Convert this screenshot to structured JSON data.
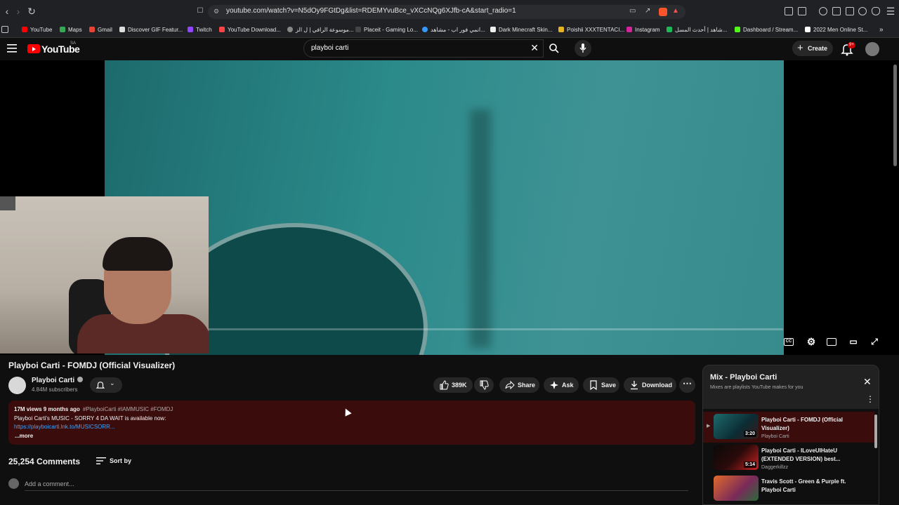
{
  "browser": {
    "url": "youtube.com/watch?v=N5dOy9FGtDg&list=RDEMYvuBce_vXCcNQg6XJfb-cA&start_radio=1",
    "bookmarks": [
      {
        "label": "YouTube",
        "color": "#ff0000"
      },
      {
        "label": "Maps",
        "color": "#34a853"
      },
      {
        "label": "Gmail",
        "color": "#ea4335"
      },
      {
        "label": "Discover GIF Featur...",
        "color": "#dddddd"
      },
      {
        "label": "Twitch",
        "color": "#9146ff"
      },
      {
        "label": "YouTube Download...",
        "color": "#ff4444"
      },
      {
        "label": "موسوعة الرافي | ل الز...",
        "color": "#888888"
      },
      {
        "label": "Placeit - Gaming Lo...",
        "color": "#444444"
      },
      {
        "label": "انمي فور اب - مشاهد...",
        "color": "#3399ff"
      },
      {
        "label": "Dark Minecraft Skin...",
        "color": "#222222"
      },
      {
        "label": "Poishii XXXTENTACI...",
        "color": "#e6b422"
      },
      {
        "label": "Instagram",
        "color": "#d6249f"
      },
      {
        "label": "شاهد | أحدث المسل...",
        "color": "#1db954"
      },
      {
        "label": "Dashboard / Stream...",
        "color": "#53fc18"
      },
      {
        "label": "2022 Men Online St...",
        "color": "#ffffff"
      }
    ]
  },
  "header": {
    "logo_text": "YouTube",
    "logo_country": "SA",
    "search_value": "playboi carti",
    "create_label": "Create",
    "notif_badge": "9+"
  },
  "video": {
    "title": "Playboi Carti - FOMDJ (Official Visualizer)",
    "progress_fraction": 0.0
  },
  "channel": {
    "name": "Playboi Carti",
    "subscribers": "4.84M subscribers"
  },
  "actions": {
    "likes": "389K",
    "share": "Share",
    "ask": "Ask",
    "save": "Save",
    "download": "Download"
  },
  "description": {
    "stats": "17M views  9 months ago",
    "tags": "#PlayboiCarti #IAMMUSIC #FOMDJ",
    "line2": "Playboi Carti's MUSIC - SORRY 4 DA WAIT is available now:",
    "link": "https://playboicarti.lnk.to/MUSICSORR...",
    "more": "...more"
  },
  "comments": {
    "count": "25,254 Comments",
    "sort_label": "Sort by",
    "add_placeholder": "Add a comment..."
  },
  "playlist": {
    "title": "Mix - Playboi Carti",
    "subtitle": "Mixes are playlists YouTube makes for you",
    "items": [
      {
        "title": "Playboi Carti - FOMDJ (Official Visualizer)",
        "channel": "Playboi Carti",
        "duration": "3:20",
        "active": true
      },
      {
        "title": "Playboi Carti - ILoveUIHateU (EXTENDED VERSION) best...",
        "channel": "Daggerkillzz",
        "duration": "5:14",
        "active": false
      },
      {
        "title": "Travis Scott - Green & Purple ft. Playboi Carti",
        "channel": "",
        "duration": "",
        "active": false
      }
    ]
  },
  "colors": {
    "accent_red": "#ff0000",
    "description_bg": "#3b0c0c",
    "link_blue": "#3ea6ff"
  }
}
